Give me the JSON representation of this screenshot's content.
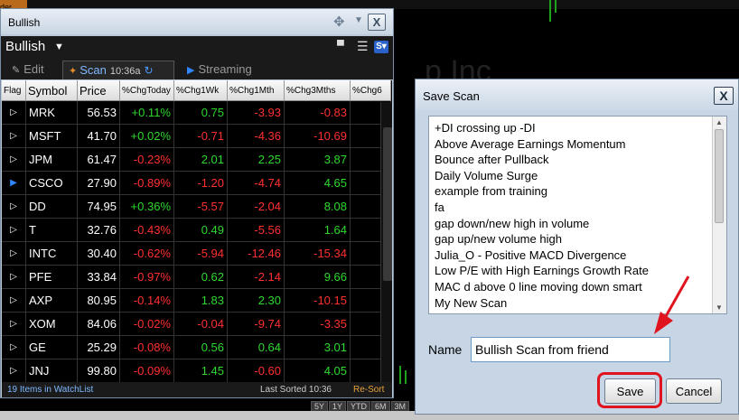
{
  "background": {
    "left_strip_text": "der",
    "period_buttons": [
      "5Y",
      "1Y",
      "YTD",
      "6M",
      "3M"
    ]
  },
  "watchlist": {
    "title": "Bullish",
    "name": "Bullish",
    "tabs": {
      "edit": "Edit",
      "scan": "Scan",
      "scan_time": "10:36a",
      "streaming": "Streaming"
    },
    "columns": [
      "Flag",
      "Symbol",
      "Price",
      "%ChgToday",
      "%Chg1Wk",
      "%Chg1Mth",
      "%Chg3Mths",
      "%Chg6"
    ],
    "rows": [
      {
        "flag": "▷",
        "symbol": "MRK",
        "price": "56.53",
        "today": "+0.11%",
        "wk": "0.75",
        "mth": "-3.93",
        "m3": "-0.83"
      },
      {
        "flag": "▷",
        "symbol": "MSFT",
        "price": "41.70",
        "today": "+0.02%",
        "wk": "-0.71",
        "mth": "-4.36",
        "m3": "-10.69"
      },
      {
        "flag": "▷",
        "symbol": "JPM",
        "price": "61.47",
        "today": "-0.23%",
        "wk": "2.01",
        "mth": "2.25",
        "m3": "3.87"
      },
      {
        "flag": "▶",
        "symbol": "CSCO",
        "price": "27.90",
        "today": "-0.89%",
        "wk": "-1.20",
        "mth": "-4.74",
        "m3": "4.65"
      },
      {
        "flag": "▷",
        "symbol": "DD",
        "price": "74.95",
        "today": "+0.36%",
        "wk": "-5.57",
        "mth": "-2.04",
        "m3": "8.08"
      },
      {
        "flag": "▷",
        "symbol": "T",
        "price": "32.76",
        "today": "-0.43%",
        "wk": "0.49",
        "mth": "-5.56",
        "m3": "1.64"
      },
      {
        "flag": "▷",
        "symbol": "INTC",
        "price": "30.40",
        "today": "-0.62%",
        "wk": "-5.94",
        "mth": "-12.46",
        "m3": "-15.34"
      },
      {
        "flag": "▷",
        "symbol": "PFE",
        "price": "33.84",
        "today": "-0.97%",
        "wk": "0.62",
        "mth": "-2.14",
        "m3": "9.66"
      },
      {
        "flag": "▷",
        "symbol": "AXP",
        "price": "80.95",
        "today": "-0.14%",
        "wk": "1.83",
        "mth": "2.30",
        "m3": "-10.15"
      },
      {
        "flag": "▷",
        "symbol": "XOM",
        "price": "84.06",
        "today": "-0.02%",
        "wk": "-0.04",
        "mth": "-9.74",
        "m3": "-3.35"
      },
      {
        "flag": "▷",
        "symbol": "GE",
        "price": "25.29",
        "today": "-0.08%",
        "wk": "0.56",
        "mth": "0.64",
        "m3": "3.01"
      },
      {
        "flag": "▷",
        "symbol": "JNJ",
        "price": "99.80",
        "today": "-0.09%",
        "wk": "1.45",
        "mth": "-0.60",
        "m3": "4.05"
      }
    ],
    "status": {
      "count": "19 Items in WatchList",
      "sorted": "Last Sorted 10:36",
      "resort": "Re-Sort"
    }
  },
  "dialog": {
    "title": "Save Scan",
    "close": "X",
    "scans": [
      "+DI crossing up -DI",
      "Above Average Earnings Momentum",
      "Bounce after Pullback",
      "Daily Volume Surge",
      "example from training",
      "fa",
      "gap down/new high in volume",
      "gap up/new volume high",
      "Julia_O - Positive MACD Divergence",
      "Low P/E with High Earnings Growth Rate",
      "MAC d above 0 line moving down smart",
      "My New Scan"
    ],
    "name_label": "Name",
    "name_value": "Bullish Scan from friend",
    "save_label": "Save",
    "cancel_label": "Cancel"
  },
  "colors": {
    "positive": "#2fd82f",
    "negative": "#ff3030",
    "highlight": "#e0141e"
  }
}
